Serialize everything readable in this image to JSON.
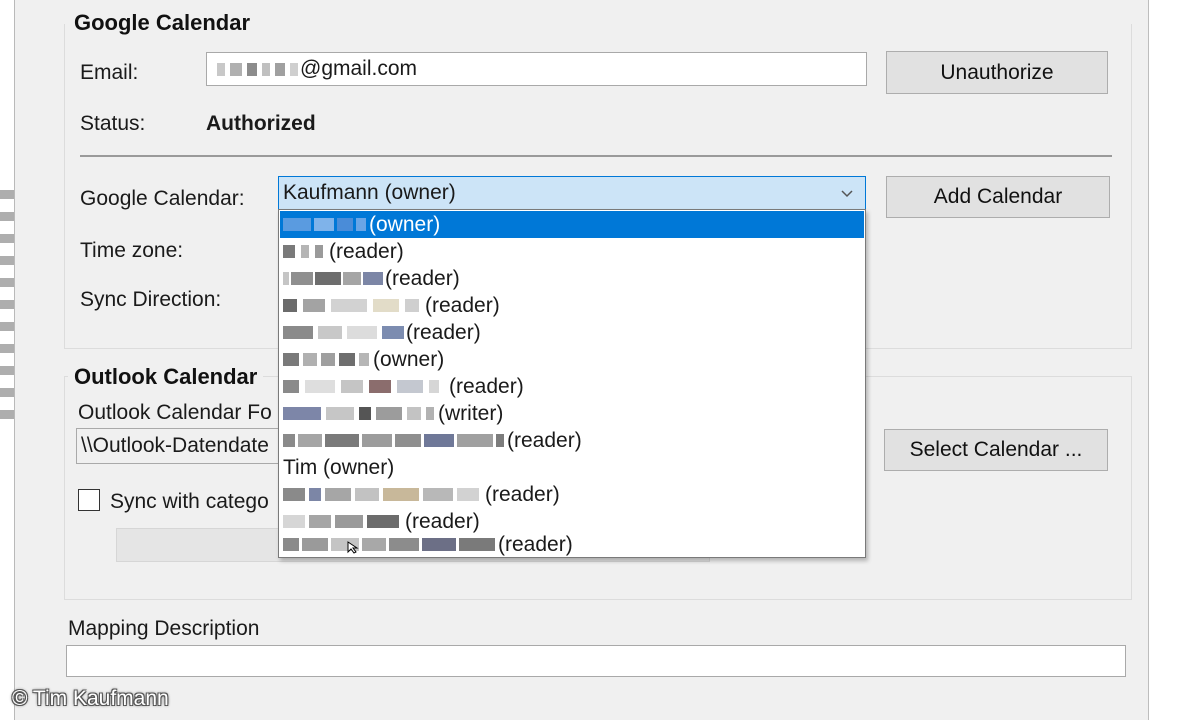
{
  "google_section": {
    "title": "Google Calendar",
    "email_label": "Email:",
    "email_value_suffix": "@gmail.com",
    "unauthorize_button": "Unauthorize",
    "status_label": "Status:",
    "status_value": "Authorized",
    "calendar_label": "Google Calendar:",
    "calendar_selected": "Kaufmann (owner)",
    "add_calendar_button": "Add Calendar",
    "timezone_label": "Time zone:",
    "sync_direction_label": "Sync Direction:"
  },
  "calendar_dropdown": {
    "items": [
      {
        "label": "(owner)",
        "selected": true
      },
      {
        "label": "(reader)",
        "selected": false
      },
      {
        "label": "(reader)",
        "selected": false
      },
      {
        "label": "(reader)",
        "selected": false
      },
      {
        "label": "(reader)",
        "selected": false
      },
      {
        "label": "(owner)",
        "selected": false
      },
      {
        "label": "(reader)",
        "selected": false
      },
      {
        "label": "(writer)",
        "selected": false
      },
      {
        "label": "(reader)",
        "selected": false
      },
      {
        "label": "Tim (owner)",
        "selected": false
      },
      {
        "label": "(reader)",
        "selected": false
      },
      {
        "label": "(reader)",
        "selected": false
      },
      {
        "label": "(reader)",
        "selected": false
      }
    ]
  },
  "outlook_section": {
    "title": "Outlook Calendar",
    "folder_label": "Outlook Calendar Fo",
    "folder_value": "\\\\Outlook-Datendate",
    "select_calendar_button": "Select Calendar ...",
    "sync_categories_label": "Sync with catego"
  },
  "mapping": {
    "label": "Mapping Description",
    "value": ""
  },
  "watermark": "© Tim Kaufmann",
  "colors": {
    "selection": "#0078d7",
    "combo_focus": "#cce4f7",
    "window_bg": "#f0f0f0"
  }
}
